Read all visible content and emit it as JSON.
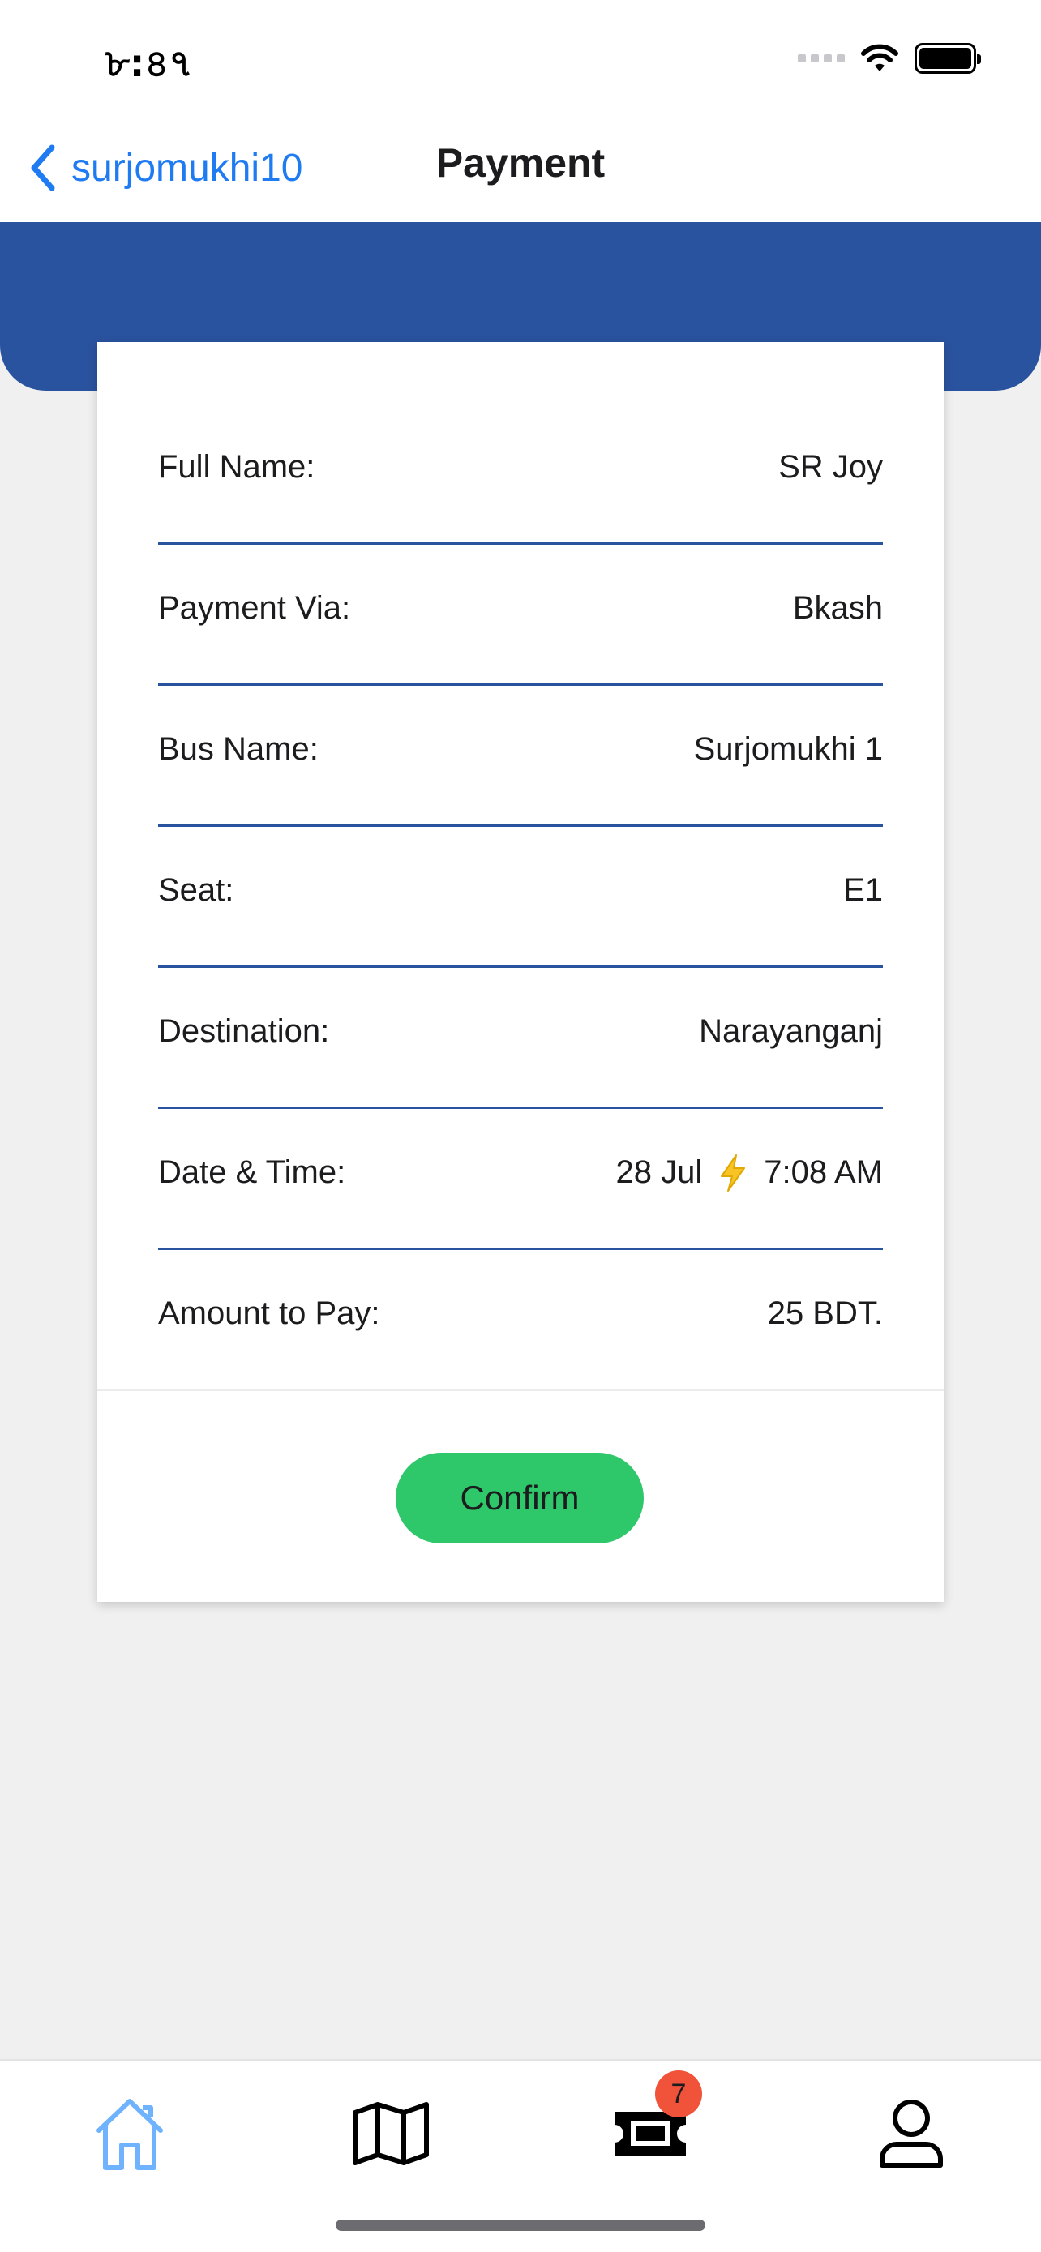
{
  "status_bar": {
    "time": "৮:৪৭"
  },
  "nav": {
    "back_label": "surjomukhi10",
    "title": "Payment"
  },
  "details": [
    {
      "label": "Full Name:",
      "value": "SR Joy"
    },
    {
      "label": "Payment Via:",
      "value": "Bkash"
    },
    {
      "label": "Bus Name:",
      "value": "Surjomukhi 1"
    },
    {
      "label": "Seat:",
      "value": "E1"
    },
    {
      "label": "Destination:",
      "value": "Narayanganj"
    },
    {
      "label": "Date & Time:",
      "value_date": "28 Jul",
      "value_time": "7:08 AM"
    },
    {
      "label": "Amount to Pay:",
      "value": "25 BDT."
    }
  ],
  "confirm_label": "Confirm",
  "tab_bar": {
    "items": [
      {
        "icon": "home-icon",
        "active": true
      },
      {
        "icon": "map-icon",
        "active": false
      },
      {
        "icon": "ticket-icon",
        "active": false,
        "badge": "7"
      },
      {
        "icon": "person-icon",
        "active": false
      }
    ]
  },
  "colors": {
    "accent": "#1e7bf2",
    "header_blue": "#2a539f",
    "confirm_green": "#2ec86b",
    "badge_red": "#f0533a"
  }
}
